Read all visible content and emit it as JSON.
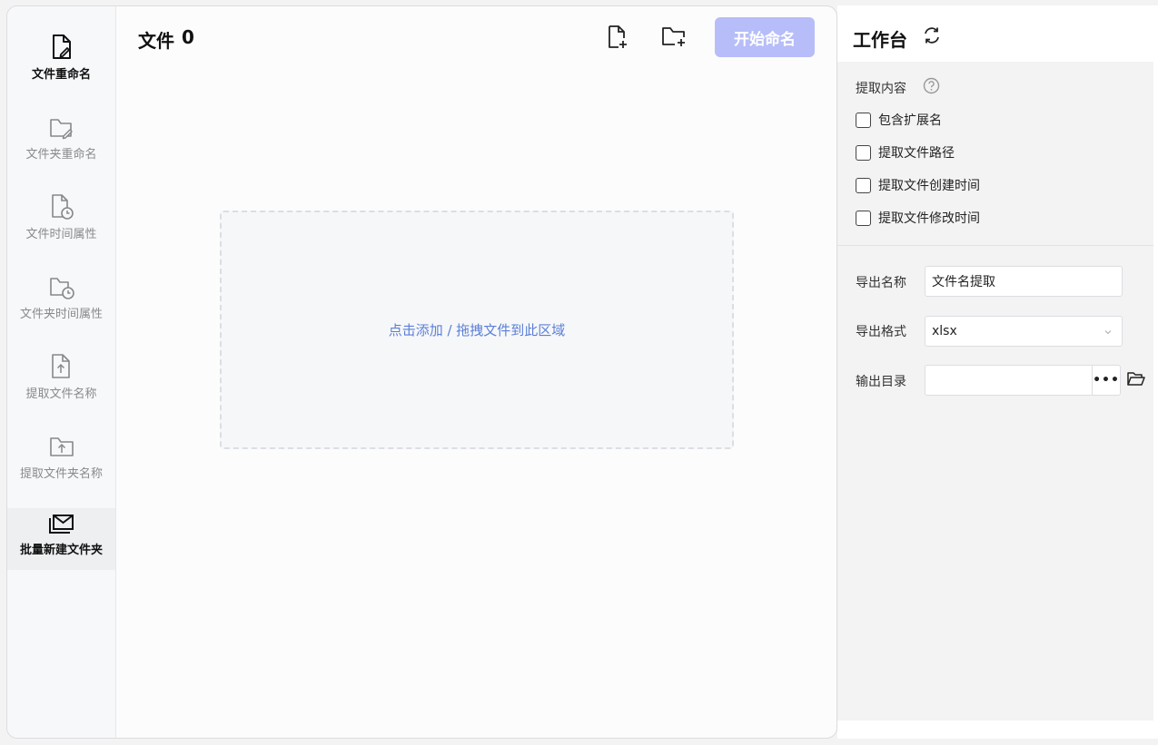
{
  "sidebar": {
    "items": [
      {
        "label": "文件重命名",
        "icon": "file-edit-icon",
        "state": "active"
      },
      {
        "label": "文件夹重命名",
        "icon": "folder-edit-icon",
        "state": "normal"
      },
      {
        "label": "文件时间属性",
        "icon": "file-clock-icon",
        "state": "normal"
      },
      {
        "label": "文件夹时间属性",
        "icon": "folder-clock-icon",
        "state": "normal"
      },
      {
        "label": "提取文件名称",
        "icon": "file-upload-icon",
        "state": "normal"
      },
      {
        "label": "提取文件夹名称",
        "icon": "folder-upload-icon",
        "state": "normal"
      },
      {
        "label": "批量新建文件夹",
        "icon": "mail-folder-icon",
        "state": "selected"
      }
    ]
  },
  "main": {
    "title_text": "文件",
    "file_count": "0",
    "add_file_icon": "add-file-icon",
    "add_folder_icon": "add-folder-icon",
    "start_button": "开始命名",
    "dropzone_text": "点击添加 / 拖拽文件到此区域"
  },
  "panel": {
    "title": "工作台",
    "refresh_icon": "refresh-icon",
    "extract_label": "提取内容",
    "help_icon": "question-circle-icon",
    "checkboxes": [
      {
        "label": "包含扩展名",
        "checked": false
      },
      {
        "label": "提取文件路径",
        "checked": false
      },
      {
        "label": "提取文件创建时间",
        "checked": false
      },
      {
        "label": "提取文件修改时间",
        "checked": false
      }
    ],
    "export_name_label": "导出名称",
    "export_name_value": "文件名提取",
    "export_format_label": "导出格式",
    "export_format_value": "xlsx",
    "output_dir_label": "输出目录",
    "output_dir_value": "",
    "browse_label": "•••"
  },
  "colors": {
    "accent_disabled": "#b7bdf9",
    "link": "#5b7fd8"
  }
}
